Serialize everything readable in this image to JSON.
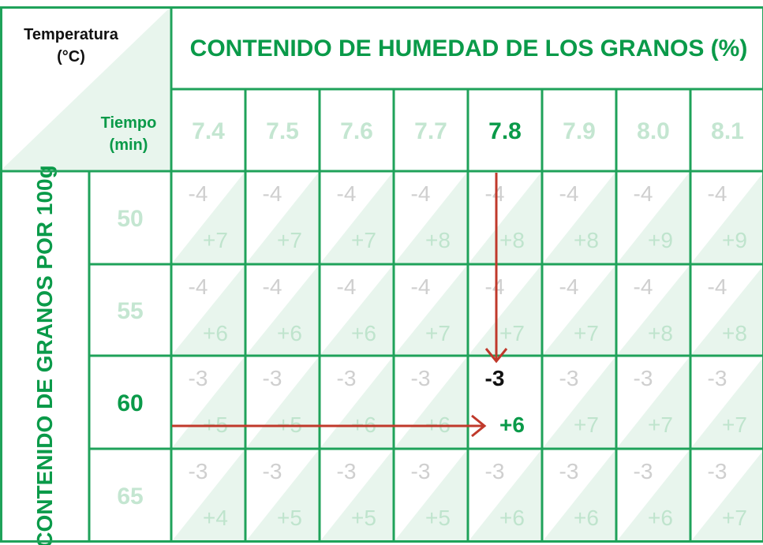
{
  "table": {
    "corner_top_line1": "Temperatura",
    "corner_top_line2": "(°C)",
    "corner_bottom_line1": "Tiempo",
    "corner_bottom_line2": "(min)",
    "header_title": "CONTENIDO DE HUMEDAD DE LOS GRANOS (%)",
    "side_title": "CONTENIDO DE GRANOS POR 100g",
    "columns": [
      "7.4",
      "7.5",
      "7.6",
      "7.7",
      "7.8",
      "7.9",
      "8.0",
      "8.1"
    ],
    "rows": [
      {
        "label": "50",
        "neg": [
          "-4",
          "-4",
          "-4",
          "-4",
          "-4",
          "-4",
          "-4",
          "-4"
        ],
        "pos": [
          "+7",
          "+7",
          "+7",
          "+8",
          "+8",
          "+8",
          "+9",
          "+9"
        ]
      },
      {
        "label": "55",
        "neg": [
          "-4",
          "-4",
          "-4",
          "-4",
          "-4",
          "-4",
          "-4",
          "-4"
        ],
        "pos": [
          "+6",
          "+6",
          "+6",
          "+7",
          "+7",
          "+7",
          "+8",
          "+8"
        ]
      },
      {
        "label": "60",
        "neg": [
          "-3",
          "-3",
          "-3",
          "-3",
          "-3",
          "-3",
          "-3",
          "-3"
        ],
        "pos": [
          "+5",
          "+5",
          "+6",
          "+6",
          "+6",
          "+7",
          "+7",
          "+7"
        ]
      },
      {
        "label": "65",
        "neg": [
          "-3",
          "-3",
          "-3",
          "-3",
          "-3",
          "-3",
          "-3",
          "-3"
        ],
        "pos": [
          "+4",
          "+5",
          "+5",
          "+5",
          "+6",
          "+6",
          "+6",
          "+7"
        ]
      }
    ],
    "highlight_column": 4,
    "highlight_row": 2
  },
  "colors": {
    "grid_green": "#1fa25a",
    "title_green": "#0a9a49",
    "triangle_fill": "#e8f5ed",
    "arrow_red": "#c0392b"
  }
}
